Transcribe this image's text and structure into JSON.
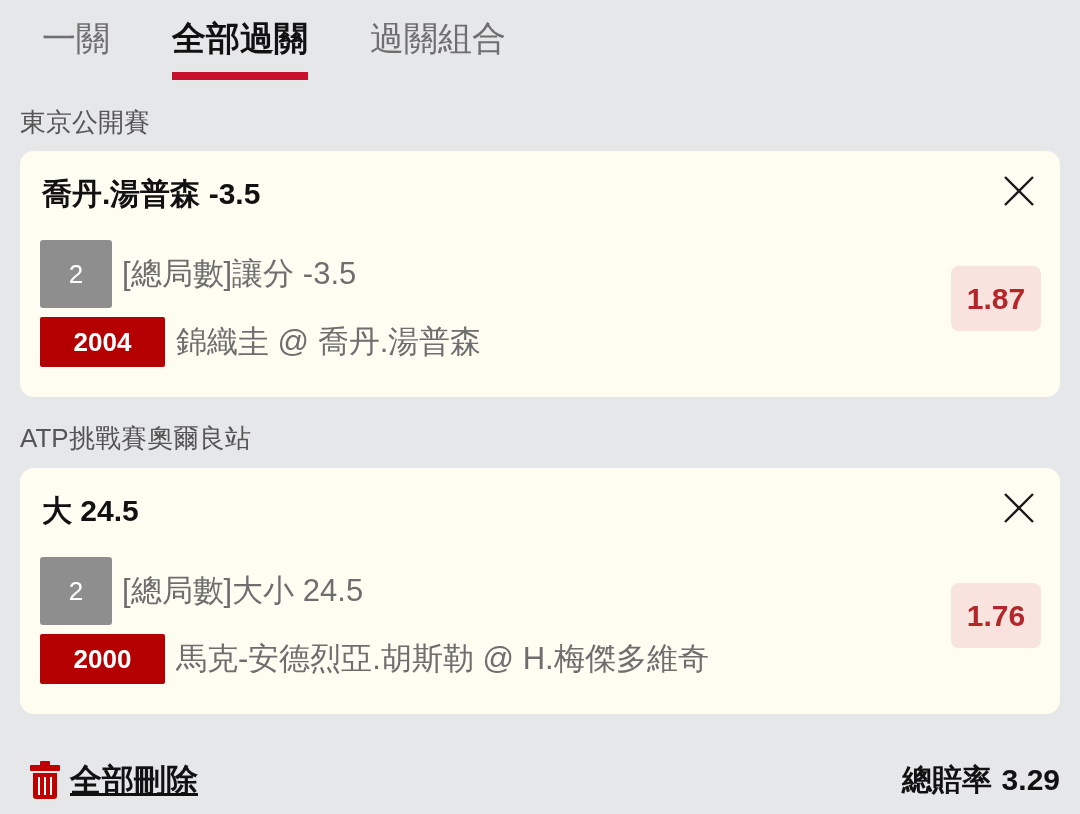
{
  "tabs": [
    {
      "label": "一關",
      "selected": false
    },
    {
      "label": "全部過關",
      "selected": true
    },
    {
      "label": "過關組合",
      "selected": false
    }
  ],
  "sections": [
    {
      "title": "東京公開賽",
      "bet": {
        "selection": "喬丹.湯普森 -3.5",
        "count": "2",
        "market": "[總局數]讓分 -3.5",
        "match_number": "2004",
        "match": "錦織圭 @ 喬丹.湯普森",
        "odds": "1.87"
      }
    },
    {
      "title": "ATP挑戰賽奧爾良站",
      "bet": {
        "selection": "大 24.5",
        "count": "2",
        "market": "[總局數]大小 24.5",
        "match_number": "2000",
        "match": "馬克-安德烈亞.胡斯勒 @ H.梅傑多維奇",
        "odds": "1.76"
      }
    }
  ],
  "footer": {
    "delete_all": "全部刪除",
    "total_odds_label": "總賠率",
    "total_odds": "3.29"
  }
}
